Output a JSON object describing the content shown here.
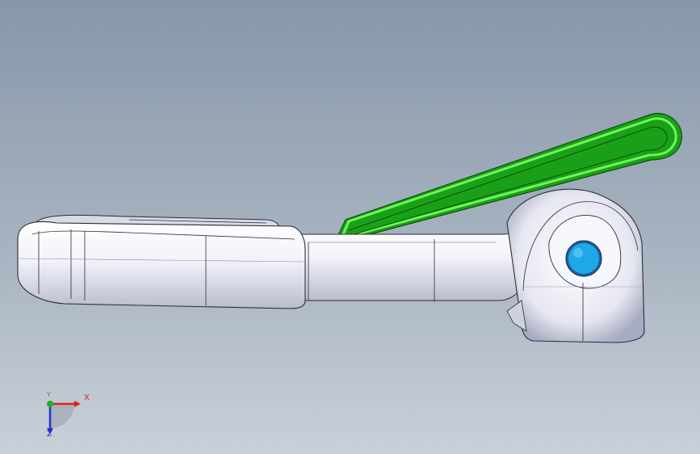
{
  "viewport": {
    "background_top": "#8797a9",
    "background_bottom": "#c9d0d9"
  },
  "model": {
    "body_color": "#eceef7",
    "edge_color": "#2b2b3a",
    "selection_color": "#22c41e",
    "pin_color": "#1ea8e6"
  },
  "triad": {
    "x_label": "X",
    "y_label": "Y",
    "z_label": "Z",
    "x_color": "#e02020",
    "y_color": "#20b020",
    "z_color": "#2030d0"
  }
}
